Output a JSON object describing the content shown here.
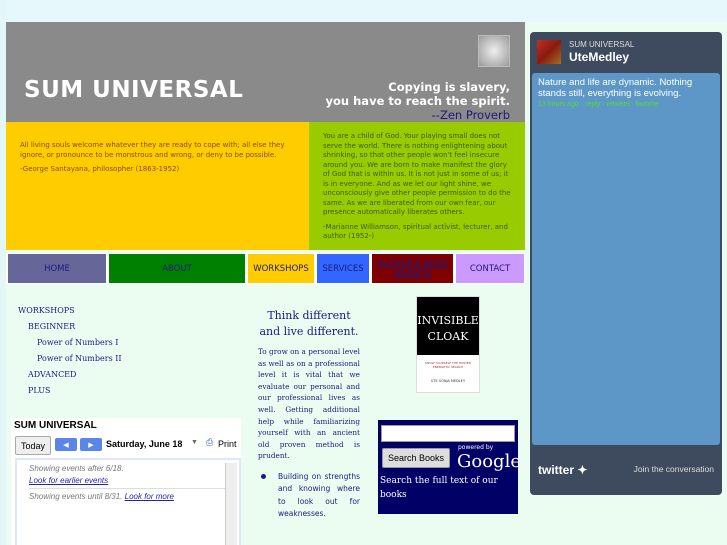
{
  "header": {
    "title": "SUM UNIVERSAL",
    "motto_line1": "Copying is slavery,",
    "motto_line2": "you have to reach the spirit.",
    "motto_source": "--Zen Proverb"
  },
  "quotes": [
    {
      "text": "All living souls welcome whatever they are ready to cope with; all else they ignore, or pronounce to be monstrous and wrong, or deny to be possible.",
      "author": "-George Santayana, philosopher (1863-1952)"
    },
    {
      "text": "You are a child of God. Your playing small does not serve the world. There is nothing enlightening about shrinking, so that other people won't feel insecure around you. We are born to make manifest the glory of God that is within us. It is not just in some of us; it is in everyone. And as we let our light shine, we unconsciously give other people permission to do the same. As we are liberated from our own fear, our presence automatically liberates others.",
      "author": "-Marianne Williamson, spiritual activist, lecturer, and author (1952-)"
    }
  ],
  "nav": [
    {
      "label": "HOME",
      "color": "#666699"
    },
    {
      "label": "ABOUT",
      "color": "#008000"
    },
    {
      "label": "WORKSHOPS",
      "color": "#ffcc00"
    },
    {
      "label": "SERVICES",
      "color": "#3366ff"
    },
    {
      "label": "AUTHOR'S BOOK WEBSITE",
      "color": "#800000"
    },
    {
      "label": "CONTACT",
      "color": "#cc99ff"
    }
  ],
  "sidebar": [
    "WORKSHOPS",
    "BEGINNER",
    "Power of Numbers I",
    "Power of Numbers II",
    "ADVANCED",
    "PLUS"
  ],
  "main": {
    "heading": "Think different and live different.",
    "body": "To grow on a personal level as well as on a professional level it is vital that we evaluate our personal and our professional lives as well. Getting additional help while familiarizing yourself with an ancient old proven method is prudent.",
    "bullet": "Building on strengths and knowing where to look out for weaknesses."
  },
  "book": {
    "title1": "INVISIBLE",
    "title2": "CLOAK",
    "subtitle": "KNOW YOURSELF THE HIDDEN ENERGETIC SEARCH",
    "author": "UTE SONJA MEDLEY"
  },
  "google_books": {
    "button": "Search Books",
    "powered": "powered by",
    "brand": "Google",
    "desc": "Search the full text of our books"
  },
  "calendar": {
    "title": "SUM UNIVERSAL",
    "today": "Today",
    "date": "Saturday, June 18",
    "print": "Print",
    "after": "Showing events after 6/18.",
    "earlier": "Look for earlier events",
    "until": "Showing events until 8/31.",
    "more": "Look for more"
  },
  "twitter": {
    "account": "SUM UNIVERSAL",
    "user": "UteMedley",
    "tweet": "Nature and life are dynamic. Nothing stands still, everything is evolving.",
    "time": "13 hours ago",
    "reply": "reply",
    "retweet": "retweet",
    "favorite": "favorite",
    "brand": "twitter",
    "join": "Join the conversation"
  }
}
